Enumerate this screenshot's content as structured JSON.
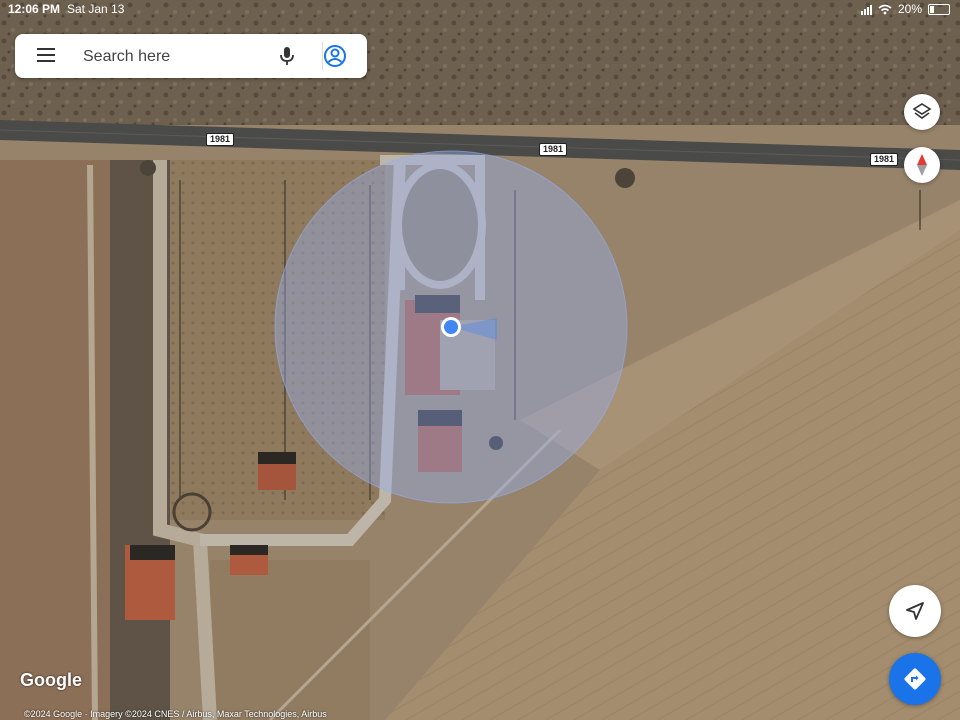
{
  "status_bar": {
    "time": "12:06 PM",
    "date": "Sat Jan 13",
    "battery_percent": "20%",
    "battery_level": 0.2
  },
  "search": {
    "placeholder": "Search here",
    "value": ""
  },
  "map": {
    "road_shields": [
      "1981",
      "1981",
      "1981"
    ],
    "google_logo": "Google",
    "attribution": "©2024 Google · Imagery ©2024 CNES / Airbus, Maxar Technologies, Airbus",
    "layer_mode": "satellite"
  },
  "colors": {
    "accent": "#1a73e8",
    "location_dot": "#4285f4",
    "compass_red": "#e53935",
    "directions_fab": "#1a73e8"
  },
  "icons": [
    "menu-icon",
    "mic-icon",
    "account-icon",
    "layers-icon",
    "compass-icon",
    "location-arrow-icon",
    "directions-icon"
  ]
}
